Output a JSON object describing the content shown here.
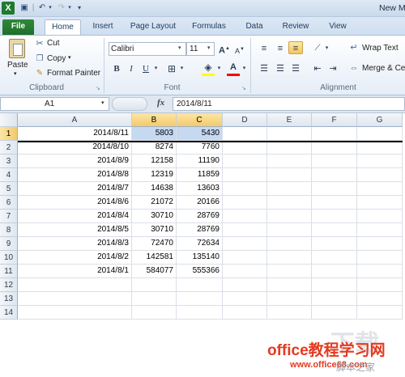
{
  "window": {
    "title_partial": "New M"
  },
  "quick_access": {
    "undo_arrow": "▾",
    "redo_arrow": "▾",
    "customize_arrow": "▾"
  },
  "tabs": [
    {
      "label": "File"
    },
    {
      "label": "Home"
    },
    {
      "label": "Insert"
    },
    {
      "label": "Page Layout"
    },
    {
      "label": "Formulas"
    },
    {
      "label": "Data"
    },
    {
      "label": "Review"
    },
    {
      "label": "View"
    }
  ],
  "clipboard": {
    "group_label": "Clipboard",
    "paste": "Paste",
    "cut": "Cut",
    "copy": "Copy",
    "format_painter": "Format Painter",
    "copy_arrow": "▾"
  },
  "font": {
    "group_label": "Font",
    "name": "Calibri",
    "size": "11",
    "bold": "B",
    "italic": "I",
    "underline": "U",
    "grow": "A",
    "shrink": "A",
    "font_color_letter": "A",
    "font_color": "#ff0000",
    "highlight_color": "#ffff00"
  },
  "alignment": {
    "group_label": "Alignment",
    "wrap_text": "Wrap Text",
    "merge_center": "Merge & Ce"
  },
  "formula_bar": {
    "name_box": "A1",
    "fx": "fx",
    "value": "2014/8/11"
  },
  "columns": [
    "A",
    "B",
    "C",
    "D",
    "E",
    "F",
    "G"
  ],
  "rows": [
    {
      "num": "1",
      "a": "2014/8/11",
      "b": "5803",
      "c": "5430"
    },
    {
      "num": "2",
      "a": "2014/8/10",
      "b": "8274",
      "c": "7760"
    },
    {
      "num": "3",
      "a": "2014/8/9",
      "b": "12158",
      "c": "11190"
    },
    {
      "num": "4",
      "a": "2014/8/8",
      "b": "12319",
      "c": "11859"
    },
    {
      "num": "5",
      "a": "2014/8/7",
      "b": "14638",
      "c": "13603"
    },
    {
      "num": "6",
      "a": "2014/8/6",
      "b": "21072",
      "c": "20166"
    },
    {
      "num": "7",
      "a": "2014/8/4",
      "b": "30710",
      "c": "28769"
    },
    {
      "num": "8",
      "a": "2014/8/5",
      "b": "30710",
      "c": "28769"
    },
    {
      "num": "9",
      "a": "2014/8/3",
      "b": "72470",
      "c": "72634"
    },
    {
      "num": "10",
      "a": "2014/8/2",
      "b": "142581",
      "c": "135140"
    },
    {
      "num": "11",
      "a": "2014/8/1",
      "b": "584077",
      "c": "555366"
    },
    {
      "num": "12",
      "a": "",
      "b": "",
      "c": ""
    },
    {
      "num": "13",
      "a": "",
      "b": "",
      "c": ""
    },
    {
      "num": "14",
      "a": "",
      "b": "",
      "c": ""
    }
  ],
  "watermark": {
    "main": "office教程学习网",
    "url": "www.office68.com",
    "tail": "脚本之家"
  }
}
